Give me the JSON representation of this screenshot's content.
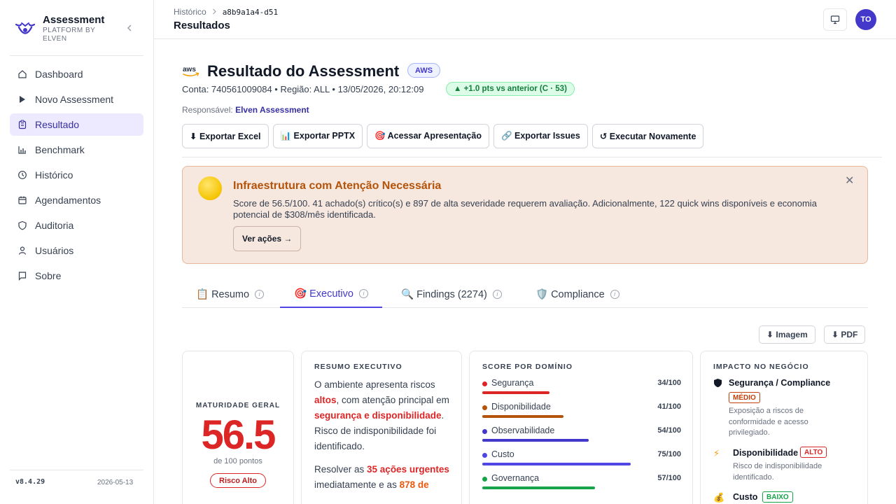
{
  "brand": {
    "title": "Assessment",
    "subtitle": "PLATFORM BY ELVEN",
    "collapse_icon": "chevron-left-icon"
  },
  "nav": {
    "items": [
      {
        "label": "Dashboard",
        "icon": "home-icon"
      },
      {
        "label": "Novo Assessment",
        "icon": "play-icon"
      },
      {
        "label": "Resultado",
        "icon": "clipboard-icon",
        "active": true
      },
      {
        "label": "Benchmark",
        "icon": "bar-chart-icon"
      },
      {
        "label": "Histórico",
        "icon": "clock-icon"
      },
      {
        "label": "Agendamentos",
        "icon": "calendar-icon"
      },
      {
        "label": "Auditoria",
        "icon": "shield-icon"
      },
      {
        "label": "Usuários",
        "icon": "user-icon"
      },
      {
        "label": "Sobre",
        "icon": "message-icon"
      }
    ]
  },
  "sidebar_footer": {
    "version": "v8.4.29",
    "date": "2026-05-13"
  },
  "header": {
    "breadcrumb": {
      "parent": "Histórico",
      "current": "a8b9a1a4-d51"
    },
    "title": "Resultados",
    "avatar_initials": "TO"
  },
  "result": {
    "provider_logo": "aws",
    "title": "Resultado do Assessment",
    "provider_badge": "AWS",
    "meta": "Conta: 740561009084 • Região: ALL • 13/05/2026, 20:12:09",
    "delta": "▲ +1.0 pts vs anterior (C · 53)",
    "responsible_label": "Responsável:",
    "responsible_name": "Elven Assessment"
  },
  "actions": [
    "⬇ Exportar Excel",
    "📊 Exportar PPTX",
    "🎯 Acessar Apresentação",
    "🔗 Exportar Issues",
    "↺ Executar Novamente"
  ],
  "alert": {
    "emoji": "yellow-circle-icon",
    "title": "Infraestrutura com Atenção Necessária",
    "text": "Score de 56.5/100. 41 achado(s) crítico(s) e 897 de alta severidade requerem avaliação. Adicionalmente, 122 quick wins disponíveis e economia potencial de $308/mês identificada.",
    "button": "Ver ações →",
    "close": "✕"
  },
  "tabs": [
    {
      "label": "📋 Resumo"
    },
    {
      "label": "🎯 Executivo",
      "active": true
    },
    {
      "label": "🔍 Findings (2274)"
    },
    {
      "label": "🛡️ Compliance"
    }
  ],
  "tab_info": "i",
  "downloads": {
    "image": "⬇ Imagem",
    "pdf": "⬇ PDF"
  },
  "maturity": {
    "label": "MATURIDADE GERAL",
    "score": "56.5",
    "sub": "de 100 pontos",
    "risk": "Risco Alto"
  },
  "executive": {
    "label": "RESUMO EXECUTIVO",
    "p1": [
      "O ambiente apresenta riscos ",
      "altos",
      ", com atenção principal em ",
      "segurança e disponibilidade",
      ". Risco de indisponibilidade foi identificado."
    ],
    "p2": [
      "Resolver as ",
      "35 ações urgentes",
      " imediatamente e as ",
      "878 de"
    ]
  },
  "domains": {
    "label": "SCORE POR DOMÍNIO",
    "items": [
      {
        "name": "Segurança",
        "value": "34/100",
        "score": 34,
        "color": "#dc2626"
      },
      {
        "name": "Disponibilidade",
        "value": "41/100",
        "score": 41,
        "color": "#b45309"
      },
      {
        "name": "Observabilidade",
        "value": "54/100",
        "score": 54,
        "color": "#4338ca"
      },
      {
        "name": "Custo",
        "value": "75/100",
        "score": 75,
        "color": "#4f46e5"
      },
      {
        "name": "Governança",
        "value": "57/100",
        "score": 57,
        "color": "#16a34a"
      }
    ]
  },
  "impact": {
    "label": "IMPACTO NO NEGÓCIO",
    "items": [
      {
        "icon": "shield-black-icon",
        "name": "Segurança / Compliance",
        "level": "MÉDIO",
        "level_color": "#c2410c",
        "desc": "Exposição a riscos de conformidade e acesso privilegiado."
      },
      {
        "icon": "lightning-icon",
        "name": "Disponibilidade",
        "level": "ALTO",
        "level_color": "#dc2626",
        "desc": "Risco de indisponibilidade identificado."
      },
      {
        "icon": "money-bag-icon",
        "name": "Custo",
        "level": "BAIXO",
        "level_color": "#16a34a",
        "desc": ""
      }
    ]
  }
}
